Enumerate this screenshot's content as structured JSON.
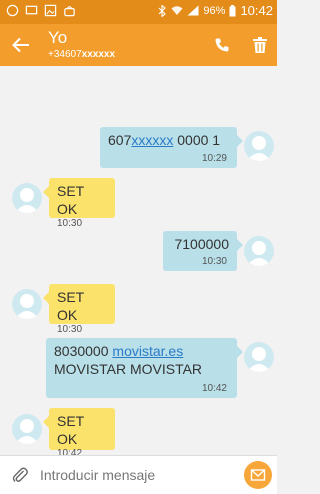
{
  "status_bar": {
    "battery": "96%",
    "time": "10:42"
  },
  "header": {
    "title": "Yo",
    "subtitle_prefix": "+34607",
    "subtitle_masked": "xxxxxx"
  },
  "messages": [
    {
      "dir": "out",
      "part1": "607",
      "link": "xxxxxx",
      "part2": " 0000 1",
      "time": "10:29"
    },
    {
      "dir": "in",
      "text": "SET OK",
      "time": "10:30"
    },
    {
      "dir": "out",
      "text": "7100000",
      "time": "10:30"
    },
    {
      "dir": "in",
      "text": "SET OK",
      "time": "10:30"
    },
    {
      "dir": "out",
      "line1_prefix": "8030000 ",
      "line1_link": "movistar.es",
      "line2": "MOVISTAR MOVISTAR",
      "time": "10:42"
    },
    {
      "dir": "in",
      "text": "SET OK",
      "time": "10:42"
    }
  ],
  "input": {
    "placeholder": "Introducir mensaje"
  },
  "colors": {
    "appbar": "#f29d2c",
    "outgoing": "#b9dfe8",
    "incoming": "#fbe26a"
  }
}
